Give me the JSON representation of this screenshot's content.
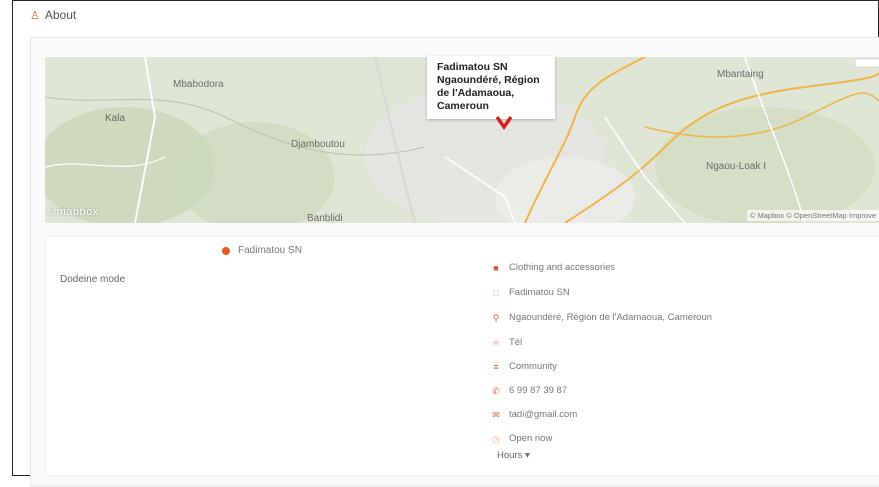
{
  "section": {
    "title": "About"
  },
  "map": {
    "popup": {
      "name": "Fadimatou SN",
      "address": "Ngaoundéré, Région de l'Adamaoua, Cameroun"
    },
    "labels": [
      "Mbabodora",
      "Kala",
      "Djamboutou",
      "Mbantaing",
      "Banblidi",
      "Ngaou-Loak I"
    ],
    "watermark": "©mapbox",
    "attribution": "© Mapbox © OpenStreetMap Improve"
  },
  "info": {
    "name": "Fadimatou SN",
    "category_label": "Dodeine mode",
    "details": [
      {
        "icon": "store-icon",
        "text": "Clothing and accessories"
      },
      {
        "icon": "user-icon",
        "text": "Fadimatou SN"
      },
      {
        "icon": "location-pin-icon",
        "text": "Ngaoundéré, Région de l'Adamaoua, Cameroun"
      },
      {
        "icon": "share-icon",
        "text": "Tél"
      },
      {
        "icon": "community-icon",
        "text": "Community"
      },
      {
        "icon": "phone-icon",
        "text": "6 99 87 39 87"
      },
      {
        "icon": "email-icon",
        "text": "tadi@gmail.com"
      },
      {
        "icon": "clock-icon",
        "text": "Open now"
      }
    ],
    "hours_link": "Hours ▾"
  },
  "colors": {
    "accent": "#e8572a",
    "map_road": "#f0b54a",
    "map_green": "#c9d9b6"
  }
}
